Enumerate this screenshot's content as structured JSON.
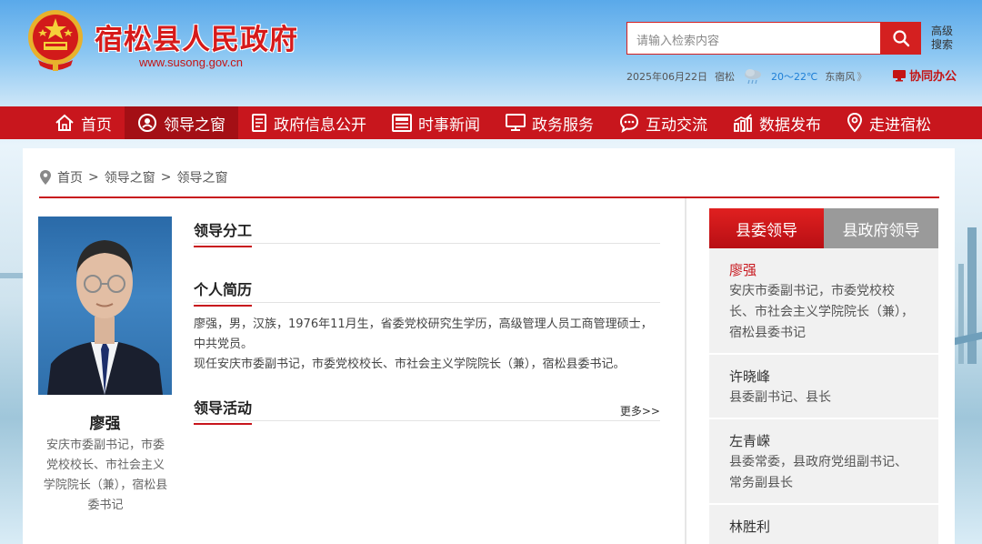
{
  "site": {
    "title": "宿松县人民政府",
    "url": "www.susong.gov.cn",
    "search_placeholder": "请输入检索内容",
    "advanced_search": "高级搜索",
    "date": "2025年06月22日",
    "city": "宿松",
    "temp_low": "20",
    "temp_high": "22℃",
    "temp_sep": "～",
    "wind": "东南风",
    "wind_arrow": "》",
    "cowork": "协同办公",
    "brand_color": "#c8161d"
  },
  "nav": {
    "items": [
      {
        "label": "首页",
        "icon": "home-icon"
      },
      {
        "label": "领导之窗",
        "icon": "leader-icon",
        "active": true
      },
      {
        "label": "政府信息公开",
        "icon": "document-icon"
      },
      {
        "label": "时事新闻",
        "icon": "news-icon"
      },
      {
        "label": "政务服务",
        "icon": "monitor-icon"
      },
      {
        "label": "互动交流",
        "icon": "chat-icon"
      },
      {
        "label": "数据发布",
        "icon": "chart-icon"
      },
      {
        "label": "走进宿松",
        "icon": "location-icon"
      }
    ]
  },
  "breadcrumb": {
    "items": [
      "首页",
      "领导之窗",
      "领导之窗"
    ],
    "sep": ">"
  },
  "leader": {
    "name": "廖强",
    "desc": "安庆市委副书记，市委党校校长、市社会主义学院院长（兼），宿松县委书记"
  },
  "sections": {
    "duty_title": "领导分工",
    "bio_title": "个人简历",
    "bio_line1": "廖强，男，汉族，1976年11月生，省委党校研究生学历，高级管理人员工商管理硕士，中共党员。",
    "bio_line2": "现任安庆市委副书记，市委党校校长、市社会主义学院院长（兼），宿松县委书记。",
    "activity_title": "领导活动",
    "more": "更多>>"
  },
  "tabs": {
    "party": "县委领导",
    "gov": "县政府领导"
  },
  "leader_list": [
    {
      "name": "廖强",
      "title": "安庆市委副书记，市委党校校长、市社会主义学院院长（兼），宿松县委书记"
    },
    {
      "name": "许晓峰",
      "title": "县委副书记、县长"
    },
    {
      "name": "左青嵘",
      "title": "县委常委，县政府党组副书记、常务副县长"
    },
    {
      "name": "林胜利",
      "title": ""
    }
  ]
}
